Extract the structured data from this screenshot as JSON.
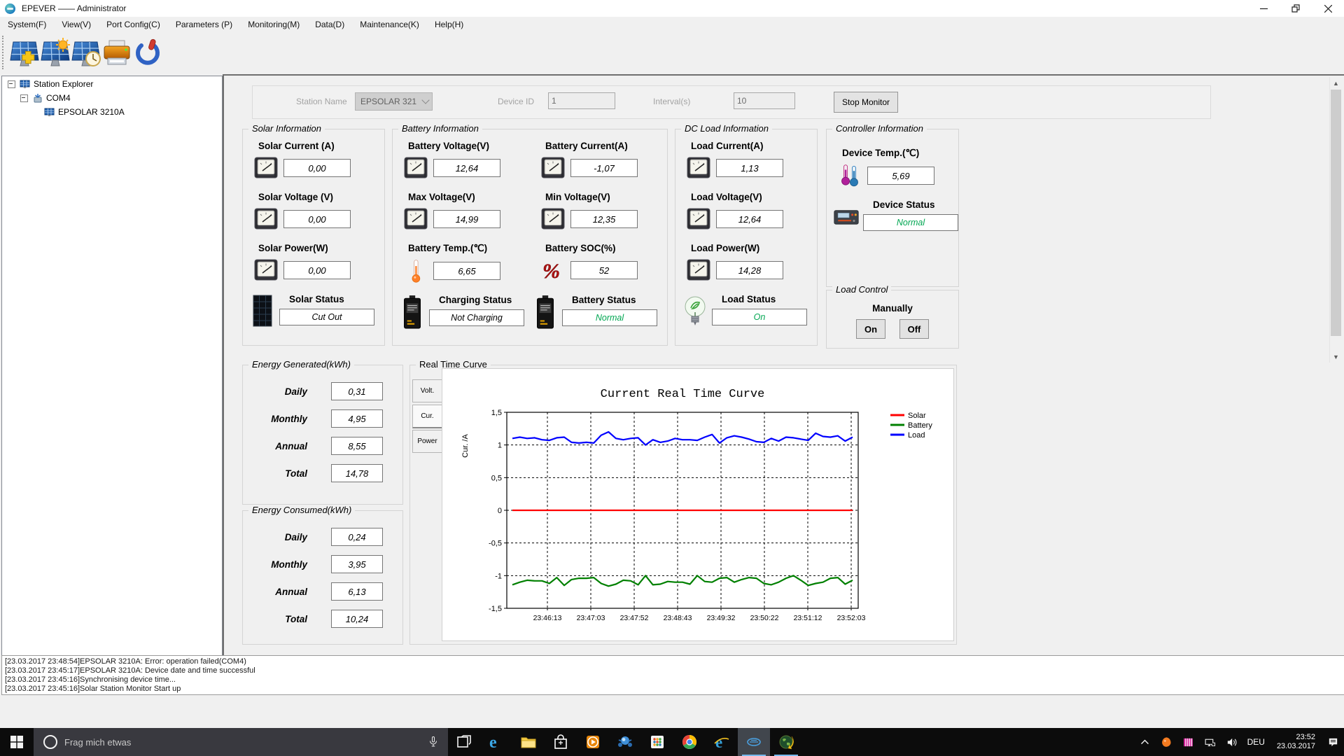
{
  "window": {
    "title": "EPEVER —— Administrator"
  },
  "menu": {
    "items": [
      "System(F)",
      "View(V)",
      "Port Config(C)",
      "Parameters (P)",
      "Monitoring(M)",
      "Data(D)",
      "Maintenance(K)",
      "Help(H)"
    ]
  },
  "toolbar": {
    "buttons": [
      "add-station",
      "station-config",
      "time-sync",
      "print",
      "exit"
    ]
  },
  "tree": {
    "root": "Station Explorer",
    "port": "COM4",
    "device": "EPSOLAR 3210A"
  },
  "station_bar": {
    "station_name_label": "Station Name",
    "station_name": "EPSOLAR 321",
    "device_id_label": "Device ID",
    "device_id": "1",
    "interval_label": "Interval(s)",
    "interval": "10",
    "stop_button": "Stop Monitor"
  },
  "panels": {
    "solar": {
      "title": "Solar Information",
      "fields": [
        {
          "label": "Solar Current (A)",
          "value": "0,00",
          "icon": "gauge"
        },
        {
          "label": "Solar Voltage (V)",
          "value": "0,00",
          "icon": "gauge"
        },
        {
          "label": "Solar Power(W)",
          "value": "0,00",
          "icon": "gauge"
        }
      ],
      "statuses": [
        {
          "label": "Solar Status",
          "value": "Cut Out",
          "color": "#000000",
          "icon": "solar-panel"
        }
      ]
    },
    "battery": {
      "title": "Battery Information",
      "fields": [
        {
          "label": "Battery Voltage(V)",
          "value": "12,64",
          "icon": "gauge"
        },
        {
          "label": "Battery Current(A)",
          "value": "-1,07",
          "icon": "gauge"
        },
        {
          "label": "Max Voltage(V)",
          "value": "14,99",
          "icon": "gauge"
        },
        {
          "label": "Min Voltage(V)",
          "value": "12,35",
          "icon": "gauge"
        },
        {
          "label": "Battery Temp.(℃)",
          "value": "6,65",
          "icon": "thermometer"
        },
        {
          "label": "Battery SOC(%)",
          "value": "52",
          "icon": "percent"
        }
      ],
      "statuses": [
        {
          "label": "Charging Status",
          "value": "Not Charging",
          "color": "#000000",
          "icon": "battery"
        },
        {
          "label": "Battery Status",
          "value": "Normal",
          "color": "#00a651",
          "icon": "battery"
        }
      ]
    },
    "dc_load": {
      "title": "DC Load Information",
      "fields": [
        {
          "label": "Load Current(A)",
          "value": "1,13",
          "icon": "gauge"
        },
        {
          "label": "Load Voltage(V)",
          "value": "12,64",
          "icon": "gauge"
        },
        {
          "label": "Load Power(W)",
          "value": "14,28",
          "icon": "gauge"
        }
      ],
      "statuses": [
        {
          "label": "Load Status",
          "value": "On",
          "color": "#00a651",
          "icon": "bulb"
        }
      ]
    },
    "controller": {
      "title": "Controller Information",
      "fields": [
        {
          "label": "Device Temp.(℃)",
          "value": "5,69",
          "icon": "dual-thermometer"
        }
      ],
      "statuses": [
        {
          "label": "Device Status",
          "value": "Normal",
          "color": "#00a651",
          "icon": "controller"
        }
      ]
    },
    "load_control": {
      "title": "Load Control",
      "mode_label": "Manually",
      "on_label": "On",
      "off_label": "Off"
    }
  },
  "energy_generated": {
    "title": "Energy Generated(kWh)",
    "rows": [
      {
        "label": "Daily",
        "value": "0,31"
      },
      {
        "label": "Monthly",
        "value": "4,95"
      },
      {
        "label": "Annual",
        "value": "8,55"
      },
      {
        "label": "Total",
        "value": "14,78"
      }
    ]
  },
  "energy_consumed": {
    "title": "Energy Consumed(kWh)",
    "rows": [
      {
        "label": "Daily",
        "value": "0,24"
      },
      {
        "label": "Monthly",
        "value": "3,95"
      },
      {
        "label": "Annual",
        "value": "6,13"
      },
      {
        "label": "Total",
        "value": "10,24"
      }
    ]
  },
  "chart_panel": {
    "title": "Real Time Curve",
    "tabs": [
      "Volt.",
      "Cur.",
      "Power"
    ],
    "active_tab": "Cur."
  },
  "chart_data": {
    "type": "line",
    "title": "Current Real Time Curve",
    "ylabel": "Cur. /A",
    "ylim": [
      -1.5,
      1.5
    ],
    "ytick_labels": [
      "1,5",
      "1",
      "0,5",
      "0",
      "-0,5",
      "-1",
      "-1,5"
    ],
    "x_tick_labels": [
      "23:46:13",
      "23:47:03",
      "23:47:52",
      "23:48:43",
      "23:49:32",
      "23:50:22",
      "23:51:12",
      "23:52:03"
    ],
    "grid": true,
    "legend_position": "right-top",
    "series": [
      {
        "name": "Solar",
        "color": "#ff0000",
        "values": [
          0,
          0,
          0,
          0,
          0,
          0,
          0,
          0,
          0,
          0,
          0,
          0,
          0,
          0,
          0,
          0,
          0,
          0,
          0,
          0,
          0,
          0,
          0,
          0,
          0,
          0,
          0,
          0,
          0,
          0,
          0,
          0,
          0,
          0,
          0,
          0,
          0,
          0,
          0,
          0,
          0,
          0,
          0,
          0,
          0,
          0,
          0
        ]
      },
      {
        "name": "Battery",
        "color": "#008000",
        "values": [
          -1.14,
          -1.1,
          -1.07,
          -1.08,
          -1.08,
          -1.12,
          -1.03,
          -1.15,
          -1.06,
          -1.04,
          -1.04,
          -1.03,
          -1.12,
          -1.16,
          -1.13,
          -1.07,
          -1.08,
          -1.14,
          -1.0,
          -1.14,
          -1.13,
          -1.09,
          -1.1,
          -1.1,
          -1.13,
          -1.0,
          -1.09,
          -1.1,
          -1.04,
          -1.03,
          -1.1,
          -1.06,
          -1.03,
          -1.04,
          -1.12,
          -1.14,
          -1.1,
          -1.04,
          -1.0,
          -1.07,
          -1.15,
          -1.12,
          -1.1,
          -1.04,
          -1.03,
          -1.13,
          -1.07
        ]
      },
      {
        "name": "Load",
        "color": "#0000ff",
        "values": [
          1.1,
          1.12,
          1.1,
          1.11,
          1.08,
          1.07,
          1.11,
          1.12,
          1.04,
          1.03,
          1.04,
          1.03,
          1.15,
          1.2,
          1.1,
          1.08,
          1.1,
          1.11,
          1.0,
          1.08,
          1.04,
          1.06,
          1.1,
          1.08,
          1.08,
          1.07,
          1.12,
          1.16,
          1.03,
          1.11,
          1.14,
          1.12,
          1.09,
          1.05,
          1.04,
          1.1,
          1.06,
          1.12,
          1.11,
          1.09,
          1.07,
          1.18,
          1.13,
          1.12,
          1.14,
          1.06,
          1.12
        ]
      }
    ]
  },
  "log": {
    "lines": [
      "[23.03.2017 23:48:54]EPSOLAR 3210A: Error: operation failed(COM4)",
      "[23.03.2017 23:45:17]EPSOLAR 3210A: Device date and time successful",
      "[23.03.2017 23:45:16]Synchronising device time...",
      "[23.03.2017 23:45:16]Solar Station Monitor Start up"
    ]
  },
  "taskbar": {
    "search_placeholder": "Frag mich etwas",
    "icons": [
      {
        "name": "task-view",
        "active": false,
        "running": false
      },
      {
        "name": "edge",
        "active": false,
        "running": false
      },
      {
        "name": "file-explorer",
        "active": false,
        "running": false
      },
      {
        "name": "store",
        "active": false,
        "running": false
      },
      {
        "name": "media-player",
        "active": false,
        "running": false
      },
      {
        "name": "dvd-player",
        "active": false,
        "running": false
      },
      {
        "name": "app-grid",
        "active": false,
        "running": false
      },
      {
        "name": "chrome",
        "active": false,
        "running": false
      },
      {
        "name": "internet-explorer",
        "active": false,
        "running": false
      },
      {
        "name": "epever-monitor",
        "active": true,
        "running": true
      },
      {
        "name": "solar-guardian",
        "active": false,
        "running": true
      }
    ],
    "tray": {
      "lang": "DEU",
      "time": "23:52",
      "date": "23.03.2017"
    }
  }
}
